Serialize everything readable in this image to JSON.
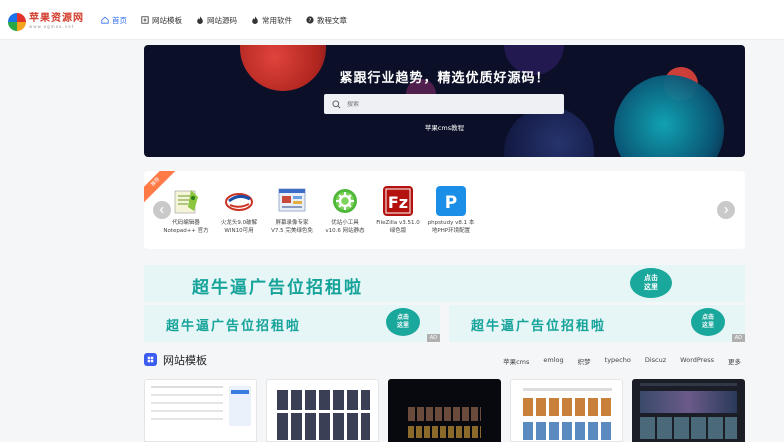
{
  "logo": {
    "text": "苹果资源网",
    "sub": "www.ogmao.net"
  },
  "nav": [
    {
      "label": "首页",
      "icon": "home-icon",
      "active": true
    },
    {
      "label": "网站模板",
      "icon": "template-icon",
      "active": false
    },
    {
      "label": "网站源码",
      "icon": "fire-icon",
      "active": false
    },
    {
      "label": "常用软件",
      "icon": "fire-icon",
      "active": false
    },
    {
      "label": "教程文章",
      "icon": "help-circle-icon",
      "active": false
    }
  ],
  "hero": {
    "title": "紧跟行业趋势，精选优质好源码！",
    "search_placeholder": "搜索",
    "link": "苹果cms教程"
  },
  "software": {
    "ribbon": "推荐",
    "items": [
      {
        "line1": "代码编辑器",
        "line2": "Notepad++ 官方"
      },
      {
        "line1": "火龙头9.0破解",
        "line2": "WIN10可用"
      },
      {
        "line1": "屏幕录像专家",
        "line2": "V7.5 完美绿色免"
      },
      {
        "line1": "优站小工具",
        "line2": "v10.6 网站静态"
      },
      {
        "line1": "FileZilla v3.51.0",
        "line2": "绿色版"
      },
      {
        "line1": "phpstudy v8.1 本",
        "line2": "地PHP环境配置"
      }
    ]
  },
  "ads": {
    "text": "超牛逼广告位招租啦",
    "button_line1": "点击",
    "button_line2": "这里",
    "tag": "AD"
  },
  "section": {
    "title": "网站模板",
    "tags": [
      "苹果cms",
      "emlog",
      "织梦",
      "typecho",
      "Discuz",
      "WordPress",
      "更多"
    ]
  },
  "colors": {
    "accent": "#2f6cf0",
    "hero_bg": "#0b1028",
    "ad_green": "#15a39a"
  }
}
